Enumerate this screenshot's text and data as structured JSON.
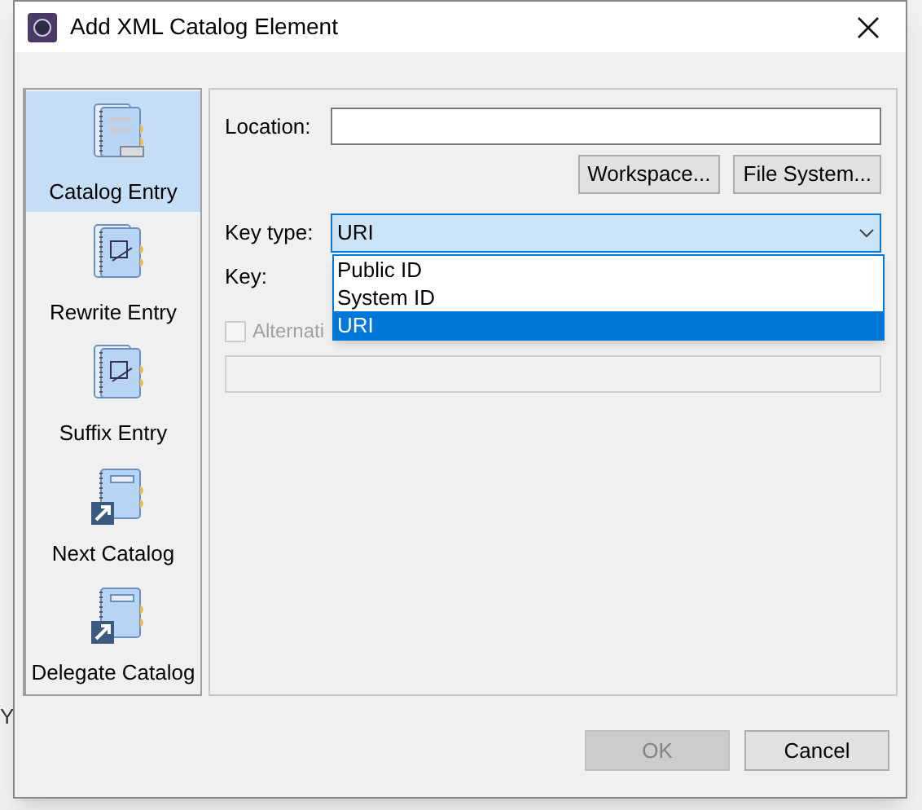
{
  "background": {
    "bottom_letter": "Y"
  },
  "window": {
    "title": "Add XML Catalog Element"
  },
  "sidebar": {
    "items": [
      {
        "label": "Catalog Entry",
        "kind": "catalog",
        "selected": true
      },
      {
        "label": "Rewrite Entry",
        "kind": "rewrite",
        "selected": false
      },
      {
        "label": "Suffix Entry",
        "kind": "suffix",
        "selected": false
      },
      {
        "label": "Next Catalog",
        "kind": "next",
        "selected": false
      },
      {
        "label": "Delegate Catalog",
        "kind": "delegate",
        "selected": false
      }
    ]
  },
  "form": {
    "location_label": "Location:",
    "browse_buttons": [
      "Workspace...",
      "File System..."
    ],
    "key_type_label": "Key type:",
    "key_type_value": "URI",
    "key_label": "Key:",
    "dropdown": {
      "expanded": true,
      "options": [
        {
          "label": "Public ID",
          "selected": false
        },
        {
          "label": "System ID",
          "selected": false
        },
        {
          "label": "URI",
          "selected": true
        }
      ]
    },
    "alternative": {
      "label": "Alternati",
      "checked": false,
      "disabled": true
    }
  },
  "buttons": [
    {
      "label": "OK",
      "disabled": true
    },
    {
      "label": "Cancel",
      "disabled": false
    }
  ]
}
